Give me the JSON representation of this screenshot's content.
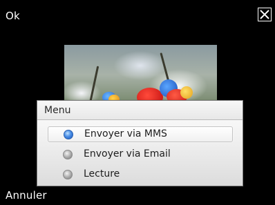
{
  "softkeys": {
    "left_top": "Ok",
    "left_bottom": "Annuler"
  },
  "menu": {
    "title": "Menu",
    "items": [
      {
        "label": "Envoyer via MMS",
        "selected": true
      },
      {
        "label": "Envoyer via Email",
        "selected": false
      },
      {
        "label": "Lecture",
        "selected": false
      }
    ]
  },
  "colors": {
    "background": "#000000",
    "accent_radio": "#3a7be0"
  },
  "icons": {
    "close": "close-icon"
  }
}
